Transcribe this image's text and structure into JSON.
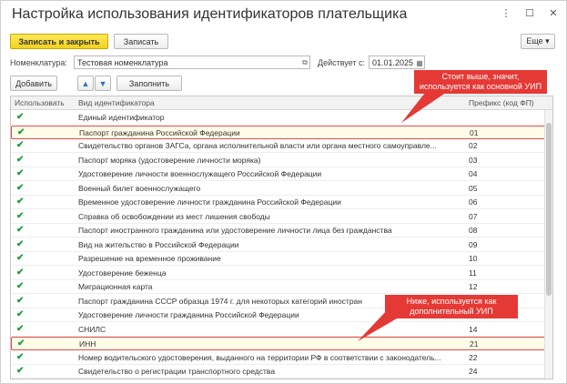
{
  "window": {
    "title": "Настройка использования идентификаторов плательщика",
    "menu_icon": "more-vertical-icon",
    "maximize_icon": "maximize-icon",
    "close_icon": "close-icon"
  },
  "toolbar": {
    "save_close_label": "Записать и закрыть",
    "save_label": "Записать",
    "more_label": "Еще ▾"
  },
  "fields": {
    "nomenclature_label": "Номенклатура:",
    "nomenclature_value": "Тестовая номенклатура",
    "effective_label": "Действует с:",
    "effective_value": "01.01.2025"
  },
  "actions": {
    "add_label": "Добавить",
    "up_icon": "arrow-up-icon",
    "down_icon": "arrow-down-icon",
    "fill_label": "Заполнить"
  },
  "grid": {
    "columns": [
      "Использовать",
      "Вид идентификатора",
      "Префикс (код ФП)"
    ],
    "rows": [
      {
        "use": true,
        "name": "Единый идентификатор",
        "code": ""
      },
      {
        "use": true,
        "name": "Паспорт гражданина Российской Федерации",
        "code": "01",
        "highlight": true
      },
      {
        "use": true,
        "name": "Свидетельство органов ЗАГСа, органа исполнительной власти или органа местного самоуправле...",
        "code": "02"
      },
      {
        "use": true,
        "name": "Паспорт моряка (удостоверение личности моряка)",
        "code": "03"
      },
      {
        "use": true,
        "name": "Удостоверение личности военнослужащего Российской Федерации",
        "code": "04"
      },
      {
        "use": true,
        "name": "Военный билет военнослужащего",
        "code": "05"
      },
      {
        "use": true,
        "name": "Временное удостоверение личности гражданина Российской Федерации",
        "code": "06"
      },
      {
        "use": true,
        "name": "Справка об освобождении из мест лишения свободы",
        "code": "07"
      },
      {
        "use": true,
        "name": "Паспорт иностранного гражданина или удостоверение личности лица без гражданства",
        "code": "08"
      },
      {
        "use": true,
        "name": "Вид на жительство в Российской Федерации",
        "code": "09"
      },
      {
        "use": true,
        "name": "Разрешение на временное проживание",
        "code": "10"
      },
      {
        "use": true,
        "name": "Удостоверение беженца",
        "code": "11"
      },
      {
        "use": true,
        "name": "Миграционная карта",
        "code": "12"
      },
      {
        "use": true,
        "name": "Паспорт гражданина СССР образца 1974 г. для некоторых категорий иностран",
        "code": ""
      },
      {
        "use": true,
        "name": "Удостоверение личности гражданина Российской Федерации",
        "code": ""
      },
      {
        "use": true,
        "name": "СНИЛС",
        "code": "14"
      },
      {
        "use": true,
        "name": "ИНН",
        "code": "21",
        "highlight": true
      },
      {
        "use": true,
        "name": "Номер водительского удостоверения, выданного на территории РФ в соответствии с законодатель...",
        "code": "22"
      },
      {
        "use": true,
        "name": "Свидетельство о регистрации транспортного средства",
        "code": "24"
      }
    ]
  },
  "callouts": {
    "top": "Стоит выше, значит, используется как основной УИП",
    "bottom": "Ниже, используется как дополнительный УИП"
  },
  "colors": {
    "primary_button": "#f4d21c",
    "callout": "#e53935",
    "checkmark": "#1f9b3a",
    "highlight_border": "#e24a4a"
  }
}
